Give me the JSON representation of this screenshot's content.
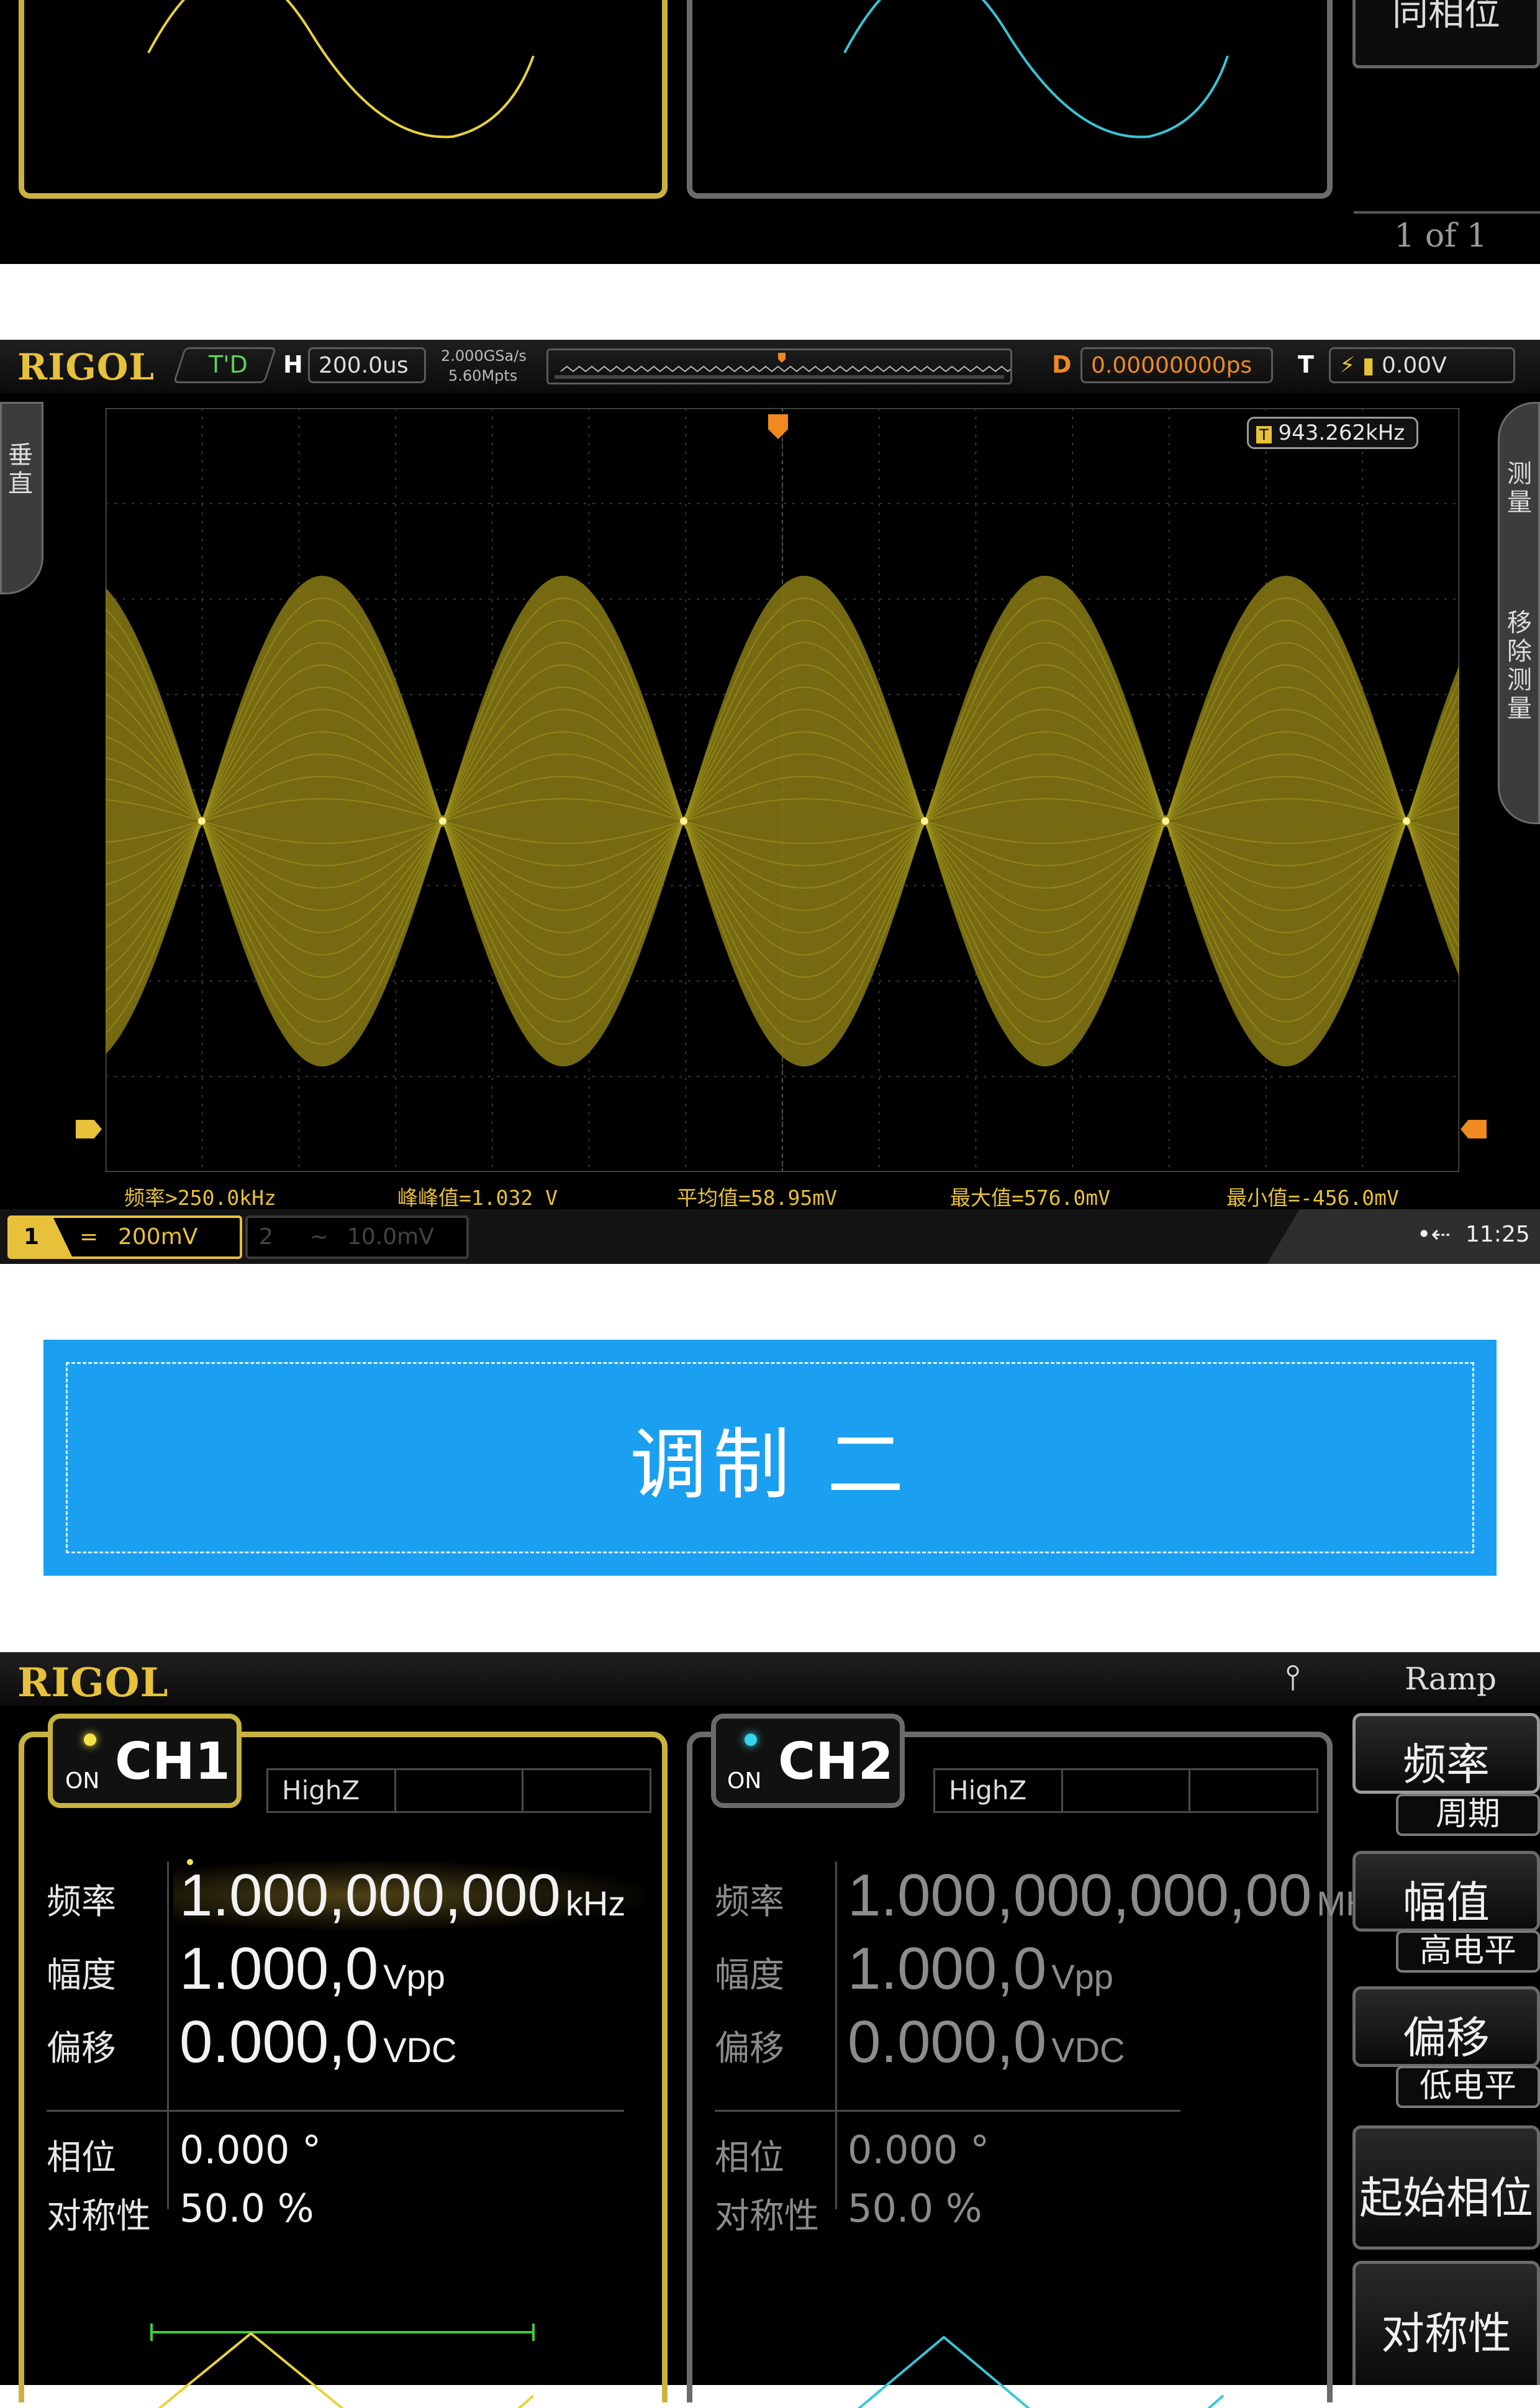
{
  "top_panel": {
    "softkey_partial": "同相位",
    "page_indicator": "1 of 1"
  },
  "scope": {
    "brand": "RIGOL",
    "mode": "T'D",
    "h_label": "H",
    "timebase": "200.0us",
    "sample_rate": "2.000GSa/s",
    "memory_depth": "5.60Mpts",
    "d_label": "D",
    "delay": "0.00000000ps",
    "t_label": "T",
    "trigger_level": "0.00V",
    "freq_counter": "943.262kHz",
    "left_tab": "垂直",
    "right_tab_top": "测量",
    "right_tab_bottom": "移除测量",
    "measurements": {
      "freq": "频率>250.0kHz",
      "vpp": "峰峰值=1.032 V",
      "avg": "平均值=58.95mV",
      "max": "最大值=576.0mV",
      "min": "最小值=-456.0mV"
    },
    "ch1_num": "1",
    "ch1_coupling": "=",
    "ch1_scale": "200mV",
    "ch2_num": "2",
    "ch2_coupling": "~",
    "ch2_scale": "10.0mV",
    "clock": "11:25",
    "colors": {
      "ch1": "#e8c13a",
      "trace": "#8a7d14"
    }
  },
  "banner": {
    "title": "调制 二"
  },
  "generator": {
    "brand": "RIGOL",
    "wave_type": "Ramp",
    "ch1": {
      "on_label": "ON",
      "name": "CH1",
      "impedance": "HighZ",
      "freq_label": "频率",
      "freq_value": "1.000,000,000",
      "freq_unit": "kHz",
      "amp_label": "幅度",
      "amp_value": "1.000,0",
      "amp_unit": "Vpp",
      "offset_label": "偏移",
      "offset_value": "0.000,0",
      "offset_unit": "VDC",
      "phase_label": "相位",
      "phase_value": "0.000 °",
      "sym_label": "对称性",
      "sym_value": "50.0 %"
    },
    "ch2": {
      "on_label": "ON",
      "name": "CH2",
      "impedance": "HighZ",
      "freq_label": "频率",
      "freq_value": "1.000,000,000,00",
      "freq_unit": "MHz",
      "amp_label": "幅度",
      "amp_value": "1.000,0",
      "amp_unit": "Vpp",
      "offset_label": "偏移",
      "offset_value": "0.000,0",
      "offset_unit": "VDC",
      "phase_label": "相位",
      "phase_value": "0.000 °",
      "sym_label": "对称性",
      "sym_value": "50.0 %"
    },
    "softkeys": {
      "freq": "频率",
      "period": "周期",
      "amp": "幅值",
      "high": "高电平",
      "offset": "偏移",
      "low": "低电平",
      "start_phase": "起始相位",
      "symmetry": "对称性"
    },
    "colors": {
      "ch1": "#e8d23a",
      "ch2": "#37c6d6"
    }
  }
}
